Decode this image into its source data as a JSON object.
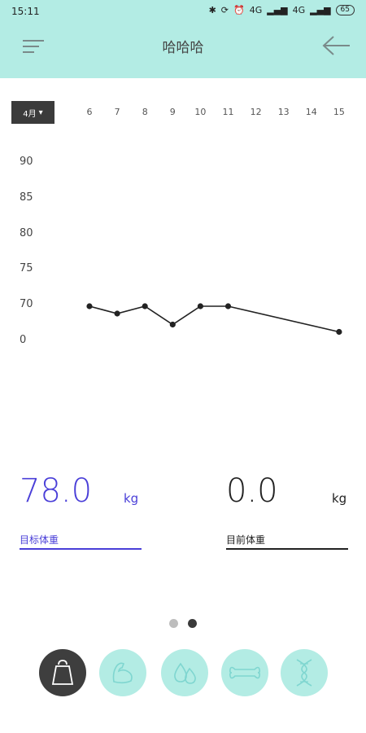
{
  "status_bar": {
    "time": "15:11",
    "network_a": "4G",
    "network_b": "4G",
    "battery": "65"
  },
  "header": {
    "title": "哈哈哈"
  },
  "chart": {
    "month_button": "4月"
  },
  "chart_data": {
    "type": "line",
    "x": [
      "6",
      "7",
      "8",
      "9",
      "10",
      "11",
      "12",
      "13",
      "14",
      "15"
    ],
    "y_ticks": [
      "90",
      "85",
      "80",
      "75",
      "70",
      "0"
    ],
    "points": [
      {
        "x": "6",
        "y": 70
      },
      {
        "x": "7",
        "y": 69
      },
      {
        "x": "8",
        "y": 70
      },
      {
        "x": "9",
        "y": 67.5
      },
      {
        "x": "10",
        "y": 70
      },
      {
        "x": "11",
        "y": 70
      },
      {
        "x": "15",
        "y": 66.5
      }
    ],
    "line_color": "#222222"
  },
  "target": {
    "value": "78.0",
    "unit": "kg",
    "label": "目标体重",
    "accent": "#4a3fd8"
  },
  "current": {
    "value": "0.0",
    "unit": "kg",
    "label": "目前体重"
  },
  "pager": {
    "active_page": 2,
    "total": 2
  },
  "bottom_nav": [
    {
      "icon": "weight-icon",
      "active": true
    },
    {
      "icon": "muscle-icon",
      "active": false
    },
    {
      "icon": "water-drop-icon",
      "active": false
    },
    {
      "icon": "bone-icon",
      "active": false
    },
    {
      "icon": "dna-icon",
      "active": false
    }
  ],
  "colors": {
    "header_bg": "#b3ece4",
    "nav_inactive": "#b3ece4",
    "nav_active": "#3e3e3e",
    "nav_icon_inactive": "#7fd6d0"
  }
}
